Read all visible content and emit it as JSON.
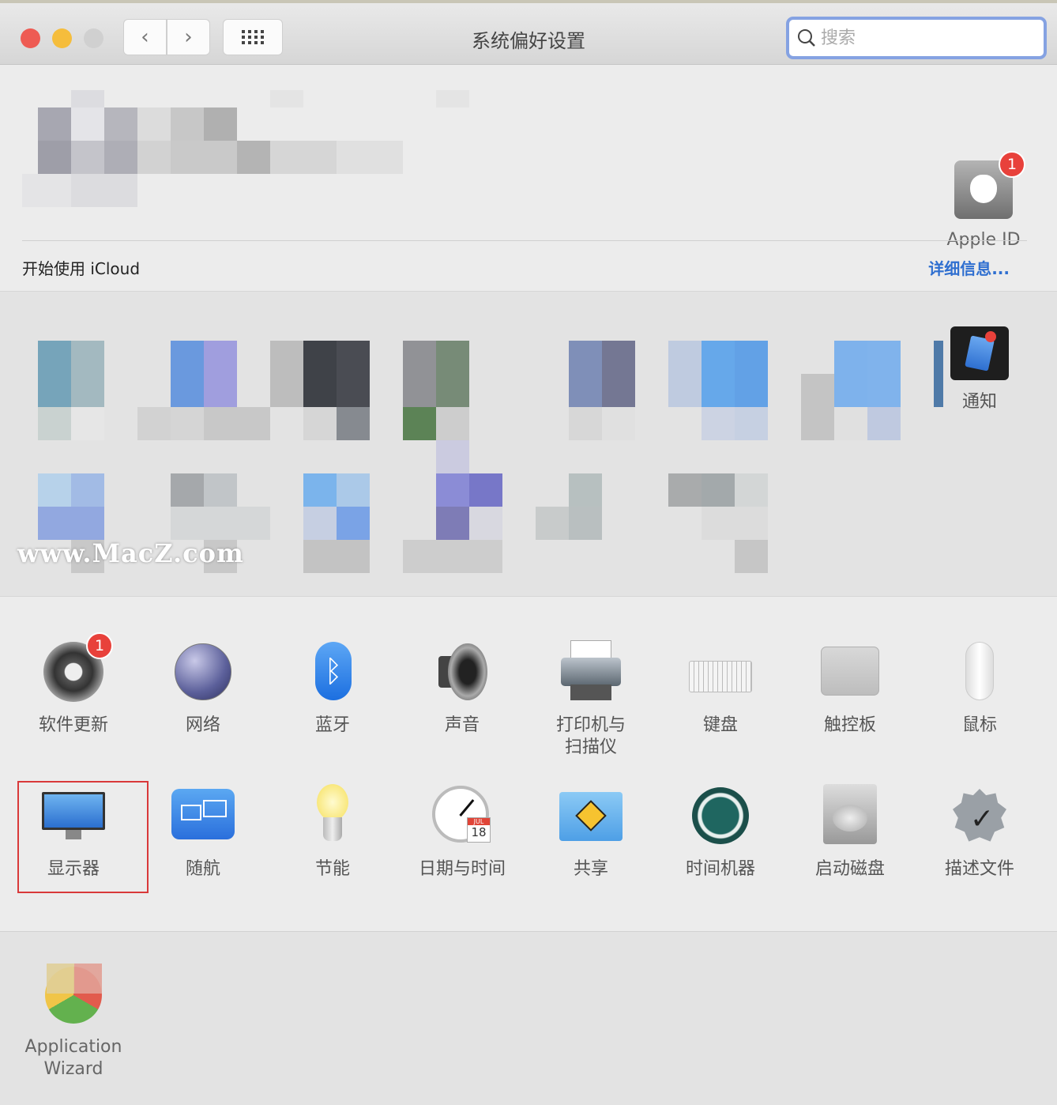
{
  "window": {
    "title": "系统偏好设置",
    "search_placeholder": "搜索"
  },
  "account": {
    "apple_id_label": "Apple ID",
    "apple_id_badge": "1",
    "icloud_prompt": "开始使用 iCloud",
    "details_link": "详细信息..."
  },
  "personal_row": {
    "visible_label": "通知",
    "icon": "notifications-icon"
  },
  "hardware_panes": [
    {
      "label": "软件更新",
      "icon": "software-update-icon",
      "badge": "1"
    },
    {
      "label": "网络",
      "icon": "network-icon"
    },
    {
      "label": "蓝牙",
      "icon": "bluetooth-icon"
    },
    {
      "label": "声音",
      "icon": "sound-icon"
    },
    {
      "label": "打印机与\n扫描仪",
      "icon": "printer-icon"
    },
    {
      "label": "键盘",
      "icon": "keyboard-icon"
    },
    {
      "label": "触控板",
      "icon": "trackpad-icon"
    },
    {
      "label": "鼠标",
      "icon": "mouse-icon"
    },
    {
      "label": "显示器",
      "icon": "display-icon",
      "highlighted": true
    },
    {
      "label": "随航",
      "icon": "sidecar-icon"
    },
    {
      "label": "节能",
      "icon": "energy-saver-icon"
    },
    {
      "label": "日期与时间",
      "icon": "date-time-icon",
      "calendar_month": "JUL",
      "calendar_day": "18"
    },
    {
      "label": "共享",
      "icon": "sharing-icon"
    },
    {
      "label": "时间机器",
      "icon": "time-machine-icon"
    },
    {
      "label": "启动磁盘",
      "icon": "startup-disk-icon"
    },
    {
      "label": "描述文件",
      "icon": "profiles-icon"
    }
  ],
  "other_panes": [
    {
      "label": "Application\nWizard",
      "icon": "application-wizard-icon"
    }
  ],
  "watermark": "www.MacZ.com",
  "colors": {
    "accent": "#2f6fd0",
    "badge": "#e8413b",
    "highlight": "#d9393a"
  }
}
